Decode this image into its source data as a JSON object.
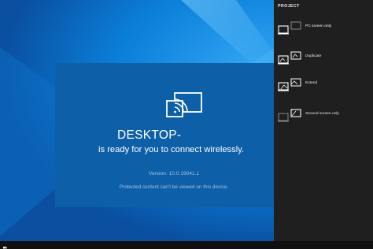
{
  "connect": {
    "device_name": "DESKTOP-",
    "ready_message": "is ready for you to connect wirelessly.",
    "version": "Version: 10.0.19041.1",
    "protected_notice": "Protected content can't be viewed on this device.",
    "icon": "wireless-display-icon"
  },
  "project": {
    "title": "PROJECT",
    "options": [
      {
        "label": "PC screen only",
        "icon": "pc-screen-only-icon",
        "selected": true
      },
      {
        "label": "Duplicate",
        "icon": "duplicate-icon",
        "selected": false
      },
      {
        "label": "Extend",
        "icon": "extend-icon",
        "selected": false
      },
      {
        "label": "Second screen only",
        "icon": "second-screen-only-icon",
        "selected": false
      }
    ]
  },
  "taskbar": {
    "start_icon": "windows-logo-icon"
  },
  "colors": {
    "wallpaper": "#0a7fd6",
    "connect_panel": "#0d5fa8",
    "project_pane": "#1f1f1f",
    "taskbar": "#101010",
    "secondary_text": "#9fc5ea"
  }
}
